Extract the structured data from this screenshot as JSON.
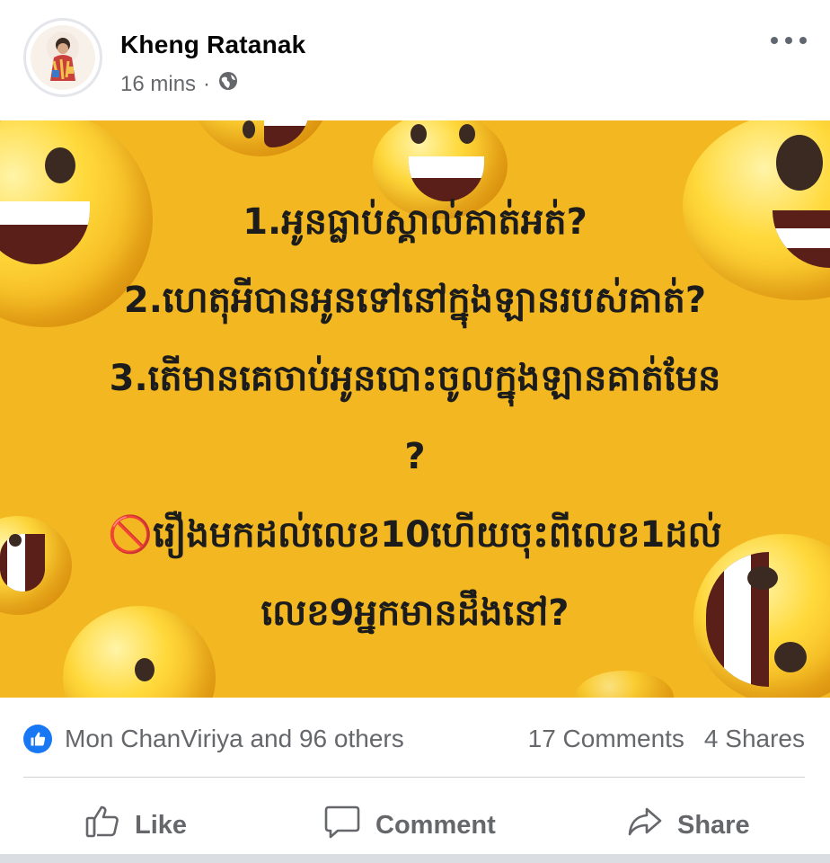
{
  "post": {
    "author": "Kheng Ratanak",
    "time": "16 mins",
    "separator": "·",
    "privacy_icon": "globe-icon",
    "menu_icon": "more-options-icon"
  },
  "image": {
    "background_color": "#f3b821",
    "text_color": "#1c1c1c",
    "lines": [
      "1.អូនធ្លាប់ស្គាល់គាត់អត់?",
      "2.ហេតុអីបានអូនទៅនៅក្នុងឡានរបស់គាត់?",
      "3.តើមានគេចាប់អូនបោះចូលក្នុងឡានគាត់មែន",
      "?",
      "🚫រឿងមកដល់លេខ10ហើយចុះពីលេខ1ដល់",
      "លេខ9អ្នកមានដឹងនៅ?"
    ]
  },
  "stats": {
    "reactions": "Mon ChanViriya and 96 others",
    "comments": "17 Comments",
    "shares": "4 Shares",
    "reaction_color": "#1877f2"
  },
  "actions": {
    "like": "Like",
    "comment": "Comment",
    "share": "Share"
  }
}
